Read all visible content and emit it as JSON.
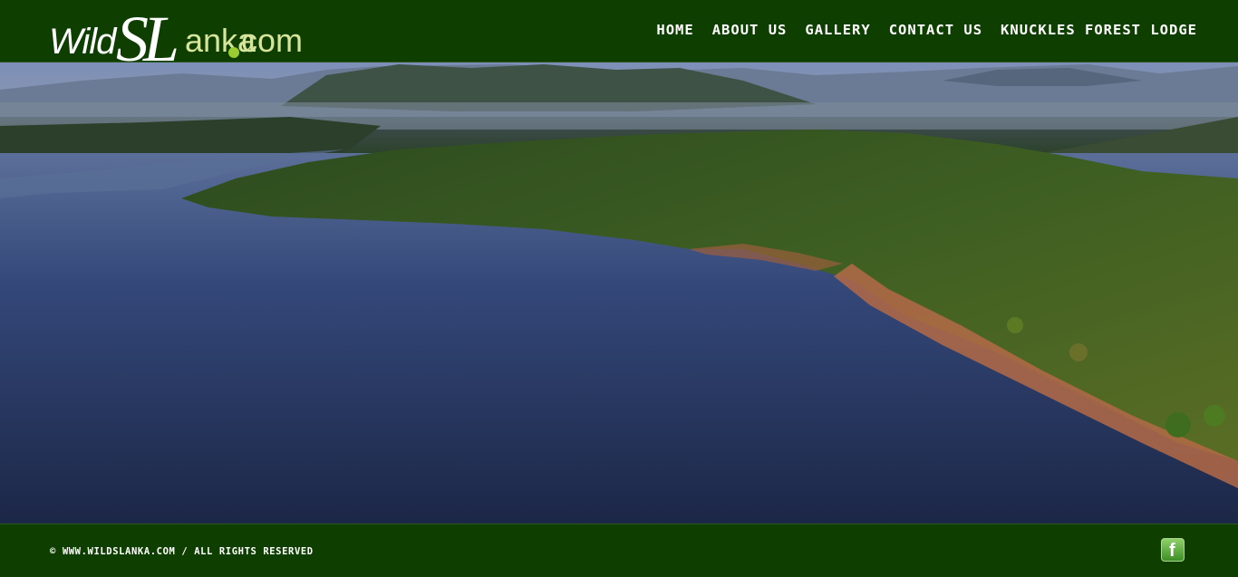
{
  "logo": {
    "wild": "Wild",
    "sl": "SL",
    "anka": "anka",
    "com": "com"
  },
  "nav": {
    "items": [
      "HOME",
      "ABOUT US",
      "GALLERY",
      "CONTACT US",
      "KNUCKLES FOREST LODGE"
    ]
  },
  "slider": {
    "total": 7,
    "active_index": 1
  },
  "footer": {
    "copyright": "© WWW.WILDSLANKA.COM / ALL RIGHTS RESERVED",
    "social_icon": "facebook-icon"
  },
  "colors": {
    "bar": "#0f3f00",
    "active_dot": "#e8e83a",
    "logo_accent": "#9acd32"
  }
}
